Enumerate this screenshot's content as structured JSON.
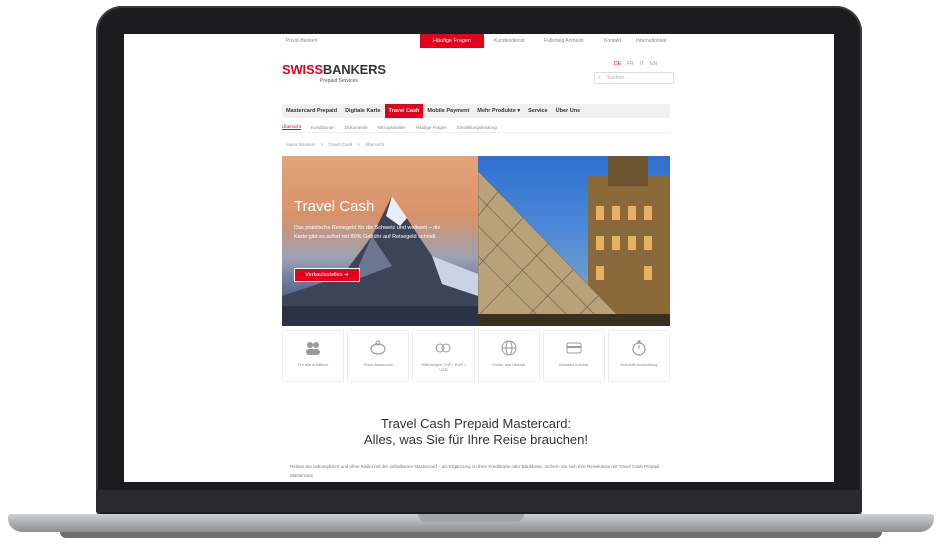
{
  "topbar": {
    "left_link": "Privat-Banken",
    "active": "Häufige Fragen",
    "links": [
      "Kundendienst",
      "Fullsrteig Anmelst",
      "Kontakt",
      "Internationaal"
    ]
  },
  "logo": {
    "swiss": "SWISS",
    "bankers": "BANKERS",
    "sub": "Prepaid Services"
  },
  "langs": [
    "DE",
    "FR",
    "IT",
    "EN"
  ],
  "search": {
    "placeholder": "Suchen"
  },
  "nav": {
    "items": [
      "Mastercard Prepaid",
      "Digitale Karte",
      "Travel Cash",
      "Mobile Payment",
      "Mehr Produkte ▾",
      "Service",
      "Über Uns"
    ],
    "active_index": 2
  },
  "subnav": [
    "Übersicht",
    "Konditionen",
    "Dokumente",
    "Bezugsstellen",
    "Häufige Fragen",
    "Einstellungsleistung"
  ],
  "breadcrumb": [
    "Swiss Bankers",
    "Travel Cash",
    "Übersicht"
  ],
  "hero": {
    "title": "Travel Cash",
    "text": "Das praktische Reisegeld für die Schweiz und weltweit – die Karte gibt es sofort mit 80% Gebühr auf Reisegeld schnell.",
    "button": "Verkaufsstellen"
  },
  "features": [
    {
      "icon": "users-icon",
      "label": "Für alle erhältlich"
    },
    {
      "icon": "piggy-bank-icon",
      "label": "Ohne Bankkonto"
    },
    {
      "icon": "coins-icon",
      "label": "Währungen CHF / EUR / USD"
    },
    {
      "icon": "globe-icon",
      "label": "Sicher und Überall"
    },
    {
      "icon": "card-icon",
      "label": "Weltweit nutzbar"
    },
    {
      "icon": "stopwatch-icon",
      "label": "Schnelle Auszahlung"
    }
  ],
  "headline": {
    "line1": "Travel Cash Prepaid Mastercard:",
    "line2": "Alles, was Sie für Ihre Reise brauchen!"
  },
  "para": "Reisen Sie unkompliziert und ohne Risiko mit der aufladbaren Mastercard – als Ergänzung zu Ihrer Kreditkarte oder Bankkarte. Sichern Sie sich Ihre Reisekasse mit Travel Cash Prepaid Mastercard."
}
